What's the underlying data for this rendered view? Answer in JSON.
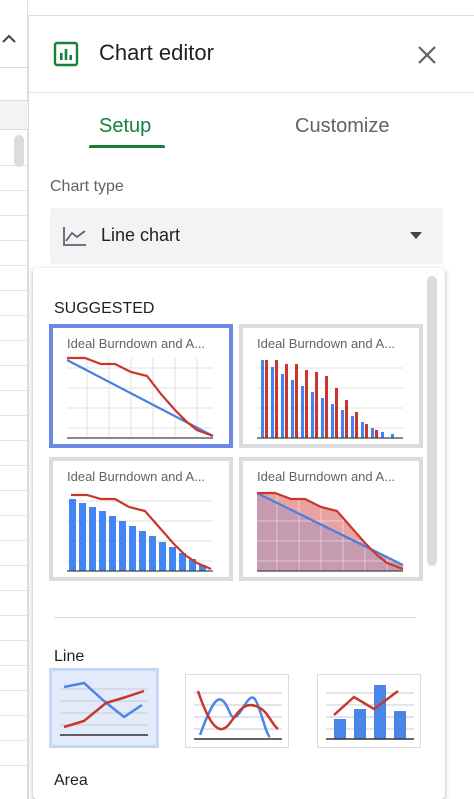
{
  "panel": {
    "title": "Chart editor",
    "tabs": [
      {
        "label": "Setup",
        "active": true
      },
      {
        "label": "Customize",
        "active": false
      }
    ]
  },
  "chart_type": {
    "label": "Chart type",
    "value": "Line chart"
  },
  "dropdown": {
    "suggested_label": "SUGGESTED",
    "suggested_title": "Ideal Burndown and A...",
    "line_label": "Line",
    "area_label": "Area"
  },
  "colors": {
    "accent_green": "#188038",
    "selected_blue": "#6b88e8",
    "series_blue": "#4285f4",
    "series_red": "#d93025"
  },
  "icons": [
    "chart-icon",
    "close-icon",
    "line-chart-icon",
    "dropdown-arrow-icon"
  ]
}
